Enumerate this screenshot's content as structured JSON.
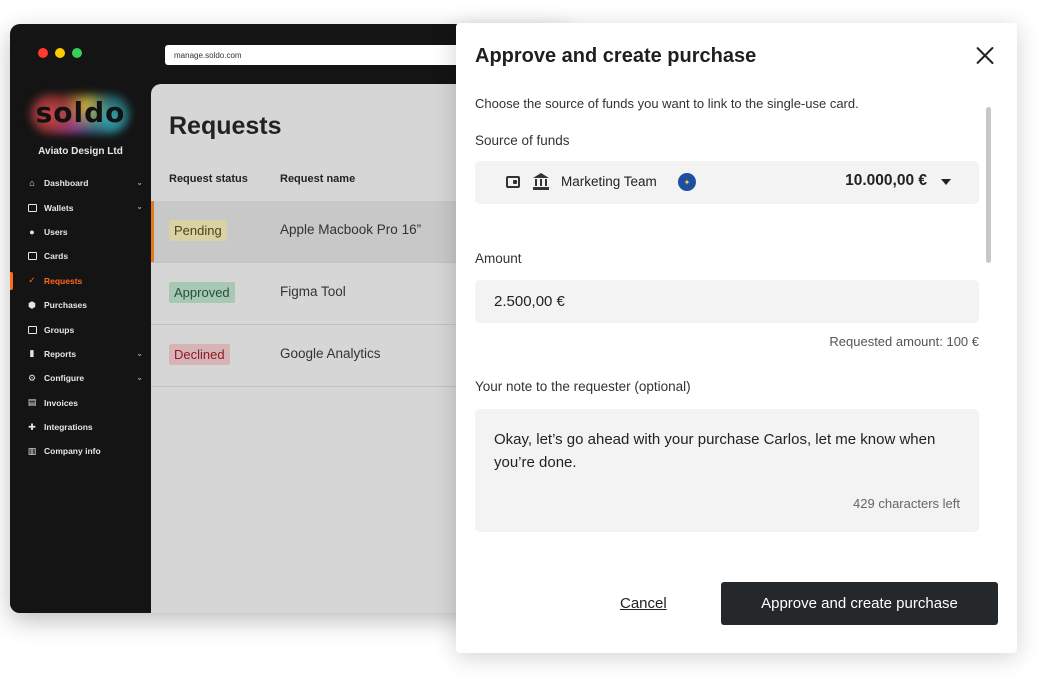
{
  "browser": {
    "url": "manage.soldo.com"
  },
  "sidebar": {
    "logo": "soldo",
    "company": "Aviato Design Ltd",
    "items": [
      {
        "label": "Dashboard"
      },
      {
        "label": "Wallets"
      },
      {
        "label": "Users"
      },
      {
        "label": "Cards"
      },
      {
        "label": "Requests"
      },
      {
        "label": "Purchases"
      },
      {
        "label": "Groups"
      },
      {
        "label": "Reports"
      },
      {
        "label": "Configure"
      },
      {
        "label": "Invoices"
      },
      {
        "label": "Integrations"
      },
      {
        "label": "Company info"
      }
    ]
  },
  "requests": {
    "title": "Requests",
    "columns": [
      "Request status",
      "Request name"
    ],
    "rows": [
      {
        "status": "Pending",
        "name": "Apple Macbook Pro 16”"
      },
      {
        "status": "Approved",
        "name": "Figma Tool"
      },
      {
        "status": "Declined",
        "name": "Google Analytics"
      }
    ]
  },
  "modal": {
    "title": "Approve and create purchase",
    "subtitle": "Choose the source of funds you want to link to the single-use card.",
    "source_label": "Source of funds",
    "source": {
      "name": "Marketing Team",
      "amount": "10.000,00 €"
    },
    "amount_label": "Amount",
    "amount_value": "2.500,00 €",
    "requested_amount": "Requested amount: 100 €",
    "note_label": "Your note to the requester (optional)",
    "note_text": "Okay, let’s go ahead with your purchase Carlos, let me know when you’re done.",
    "chars_left": "429 characters left",
    "cancel_label": "Cancel",
    "approve_label": "Approve and create purchase"
  },
  "colors": {
    "accent": "#ff6a1a",
    "primary_button": "#24282b",
    "pending_bg": "#d9d2a6",
    "approved_bg": "#a8c8b4",
    "declined_bg": "#d6b4b6"
  }
}
